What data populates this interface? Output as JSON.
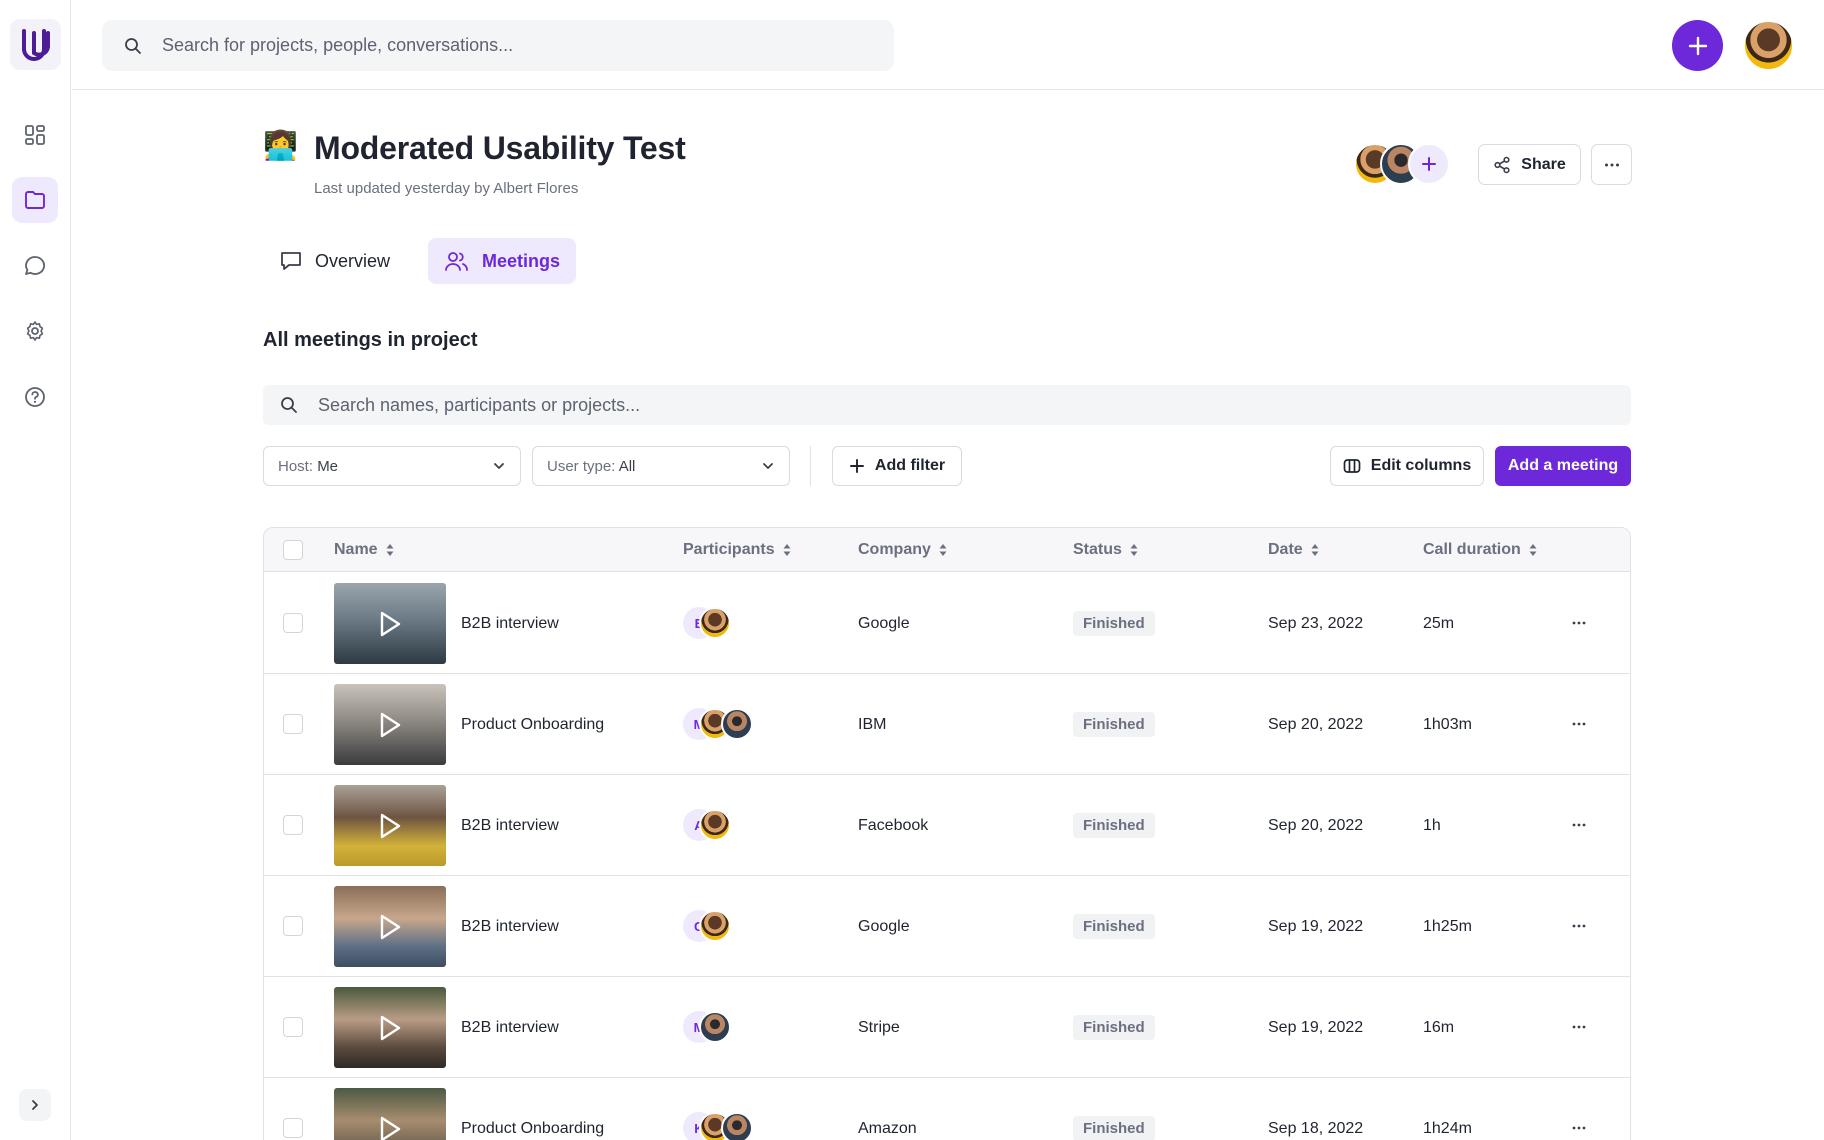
{
  "topbar": {
    "search_placeholder": "Search for projects, people, conversations..."
  },
  "sidebar": {
    "items": [
      {
        "icon": "dashboard-icon",
        "active": false
      },
      {
        "icon": "folder-icon",
        "active": true
      },
      {
        "icon": "chat-icon",
        "active": false
      },
      {
        "icon": "gear-icon",
        "active": false
      },
      {
        "icon": "help-icon",
        "active": false
      }
    ]
  },
  "project": {
    "emoji": "👩‍💻",
    "title": "Moderated Usability Test",
    "subtitle": "Last updated yesterday by Albert Flores",
    "share_label": "Share"
  },
  "tabs": [
    {
      "label": "Overview",
      "active": false
    },
    {
      "label": "Meetings",
      "active": true
    }
  ],
  "section": {
    "title": "All meetings in project",
    "search_placeholder": "Search names, participants or projects..."
  },
  "filters": {
    "host_label": "Host:",
    "host_value": "Me",
    "user_type_label": "User type:",
    "user_type_value": "All",
    "add_filter_label": "Add filter",
    "edit_columns_label": "Edit columns",
    "add_meeting_label": "Add a meeting"
  },
  "table": {
    "columns": [
      "Name",
      "Participants",
      "Company",
      "Status",
      "Date",
      "Call duration"
    ],
    "rows": [
      {
        "name": "B2B interview",
        "initial": "E",
        "company": "Google",
        "status": "Finished",
        "date": "Sep 23, 2022",
        "duration": "25m"
      },
      {
        "name": "Product Onboarding",
        "initial": "M",
        "company": "IBM",
        "status": "Finished",
        "date": "Sep 20, 2022",
        "duration": "1h03m"
      },
      {
        "name": "B2B interview",
        "initial": "A",
        "company": "Facebook",
        "status": "Finished",
        "date": "Sep 20, 2022",
        "duration": "1h"
      },
      {
        "name": "B2B interview",
        "initial": "G",
        "company": "Google",
        "status": "Finished",
        "date": "Sep 19, 2022",
        "duration": "1h25m"
      },
      {
        "name": "B2B interview",
        "initial": "M",
        "company": "Stripe",
        "status": "Finished",
        "date": "Sep 19, 2022",
        "duration": "16m"
      },
      {
        "name": "Product Onboarding",
        "initial": "K",
        "company": "Amazon",
        "status": "Finished",
        "date": "Sep 18, 2022",
        "duration": "1h24m"
      }
    ]
  },
  "colors": {
    "accent": "#6d28d9",
    "accent_soft": "#efe9fd"
  }
}
